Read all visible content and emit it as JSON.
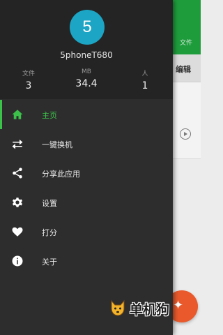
{
  "background": {
    "toolbar_files": "文件",
    "edit_label": "编辑"
  },
  "drawer": {
    "avatar_letter": "5",
    "device_name": "5phoneT680",
    "stats": [
      {
        "label": "文件",
        "value": "3"
      },
      {
        "label": "MB",
        "value": "34.4"
      },
      {
        "label": "人",
        "value": "1"
      }
    ],
    "menu": [
      {
        "label": "主页",
        "icon": "home-icon",
        "active": true
      },
      {
        "label": "一键换机",
        "icon": "swap-icon",
        "active": false
      },
      {
        "label": "分享此应用",
        "icon": "share-icon",
        "active": false
      },
      {
        "label": "设置",
        "icon": "gear-icon",
        "active": false
      },
      {
        "label": "打分",
        "icon": "heart-icon",
        "active": false
      },
      {
        "label": "关于",
        "icon": "info-icon",
        "active": false
      }
    ]
  },
  "watermark": {
    "text": "单机狗"
  },
  "colors": {
    "accent": "#3cc14a",
    "avatar": "#1ca5c4",
    "drawer_bg": "#2d2d2d",
    "toolbar_bg": "#1e9c3c",
    "fab": "#e9592b"
  }
}
